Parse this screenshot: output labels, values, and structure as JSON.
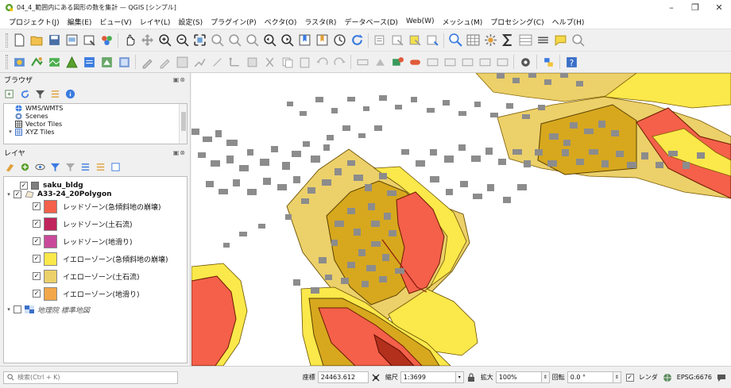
{
  "window": {
    "title": "04_4_範囲内にある図形の数を集計 — QGIS [シンプル]",
    "controls": [
      "–",
      "❐",
      "✕"
    ]
  },
  "menu": [
    "プロジェクト(J)",
    "編集(E)",
    "ビュー(V)",
    "レイヤ(L)",
    "設定(S)",
    "プラグイン(P)",
    "ベクタ(O)",
    "ラスタ(R)",
    "データベース(D)",
    "Web(W)",
    "メッシュ(M)",
    "プロセシング(C)",
    "ヘルプ(H)"
  ],
  "browser": {
    "title": "ブラウザ",
    "panel_buttons": "▣⊗",
    "items": [
      {
        "label": "WMS/WMTS",
        "icon": "globe-icon"
      },
      {
        "label": "Scenes",
        "icon": "scene-icon"
      },
      {
        "label": "Vector Tiles",
        "icon": "grid-icon"
      },
      {
        "label": "XYZ Tiles",
        "icon": "grid-icon"
      }
    ]
  },
  "layers": {
    "title": "レイヤ",
    "panel_buttons": "▣⊗",
    "items": [
      {
        "label": "saku_bldg",
        "checked": true,
        "bold": true,
        "color": "#7f7f7f"
      },
      {
        "label": "A33-24_20Polygon",
        "checked": true,
        "bold": true,
        "group": true
      },
      {
        "label": "レッドゾーン(急傾斜地の崩壊)",
        "checked": true,
        "color": "#f4604a"
      },
      {
        "label": "レッドゾーン(土石流)",
        "checked": true,
        "color": "#c0245c"
      },
      {
        "label": "レッドゾーン(地滑り)",
        "checked": true,
        "color": "#c94a9a"
      },
      {
        "label": "イエローゾーン(急傾斜地の崩壊)",
        "checked": true,
        "color": "#fbe84a"
      },
      {
        "label": "イエローゾーン(土石流)",
        "checked": true,
        "color": "#ecd06a"
      },
      {
        "label": "イエローゾーン(地滑り)",
        "checked": true,
        "color": "#f3a74a"
      },
      {
        "label": "地理院 標準地図",
        "checked": false,
        "italic": true
      }
    ]
  },
  "status": {
    "search_placeholder": "検索(Ctrl + K)",
    "coord_label": "座標",
    "coord_value": "24463.612",
    "scale_label": "縮尺",
    "scale_value": "1:3699",
    "magnifier_label": "拡大",
    "magnifier_value": "100%",
    "rotation_label": "回転",
    "rotation_value": "0.0 °",
    "render_label": "レンダ",
    "crs_label": "EPSG:6676"
  },
  "colors": {
    "red_slope": "#f4604a",
    "red_debris": "#c0245c",
    "yellow_slope": "#fbe84a",
    "yellow_debris": "#ecd06a",
    "yellow_landslide": "#f3a74a",
    "buildings": "#8c8c8c"
  }
}
